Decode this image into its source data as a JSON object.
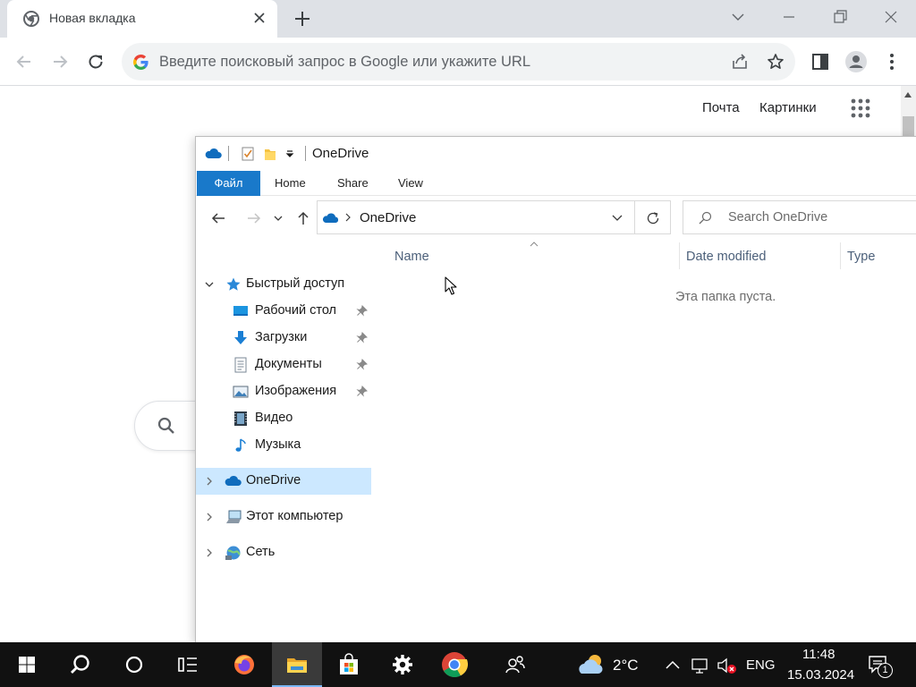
{
  "browser": {
    "tab_title": "Новая вкладка",
    "omnibox_placeholder": "Введите поисковый запрос в Google или укажите URL"
  },
  "google_page": {
    "mail_link": "Почта",
    "images_link": "Картинки"
  },
  "explorer": {
    "title": "OneDrive",
    "ribbon_tabs": [
      "Файл",
      "Home",
      "Share",
      "View"
    ],
    "address": "OneDrive",
    "search_placeholder": "Search OneDrive",
    "columns": [
      "Name",
      "Date modified",
      "Type"
    ],
    "empty_message": "Эта папка пуста.",
    "nav": {
      "quick_access": "Быстрый доступ",
      "desktop": "Рабочий стол",
      "downloads": "Загрузки",
      "documents": "Документы",
      "pictures": "Изображения",
      "videos": "Видео",
      "music": "Музыка",
      "onedrive": "OneDrive",
      "this_pc": "Этот компьютер",
      "network": "Сеть"
    }
  },
  "taskbar": {
    "weather_temp": "2°C",
    "language": "ENG",
    "time": "11:48",
    "date": "15.03.2024",
    "notification_count": "1"
  },
  "colors": {
    "accent_blue": "#1979ca",
    "selection": "#cce8ff",
    "taskbar": "#111111"
  }
}
